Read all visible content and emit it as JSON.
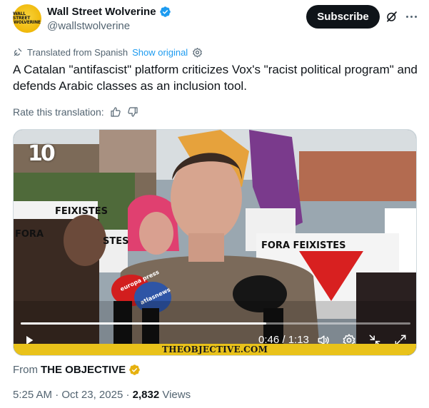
{
  "header": {
    "avatar_text_line1": "WALL STREET",
    "avatar_text_line2": "WOLVERINE",
    "display_name": "Wall Street Wolverine",
    "handle": "@wallstwolverine",
    "subscribe_label": "Subscribe"
  },
  "translation": {
    "translated_from": "Translated from Spanish",
    "show_original": "Show original",
    "rate_label": "Rate this translation:"
  },
  "tweet": {
    "text": "A Catalan \"antifascist\" platform criticizes Vox's \"racist political program\" and defends Arabic classes as an inclusion tool."
  },
  "video": {
    "channel_logo": "10",
    "time": "0:46 / 1:13",
    "progress": 0.63,
    "brand_text": "THEOBJECTIVE.COM",
    "sign_left": "FEIXISTES",
    "sign_left2": "FORA",
    "sign_right": "FORA FEIXISTES",
    "sign_center": "STES",
    "mic_left_text": "europa press",
    "mic_center_text": "atlasnews"
  },
  "source": {
    "from_label": "From",
    "name": "THE OBJECTIVE"
  },
  "meta": {
    "time": "5:25 AM",
    "date": "Oct 23, 2025",
    "views_count": "2,832",
    "views_label": "Views"
  },
  "colors": {
    "accent": "#1d9bf0",
    "verified_gold": "#e6b10f",
    "text_primary": "#0f1419",
    "text_secondary": "#536471"
  },
  "icons": [
    "verified-badge-icon",
    "grok-icon",
    "more-icon",
    "translate-icon",
    "settings-icon",
    "thumbs-up-icon",
    "thumbs-down-icon",
    "play-icon",
    "volume-icon",
    "settings-icon",
    "minimize-icon",
    "fullscreen-icon"
  ]
}
